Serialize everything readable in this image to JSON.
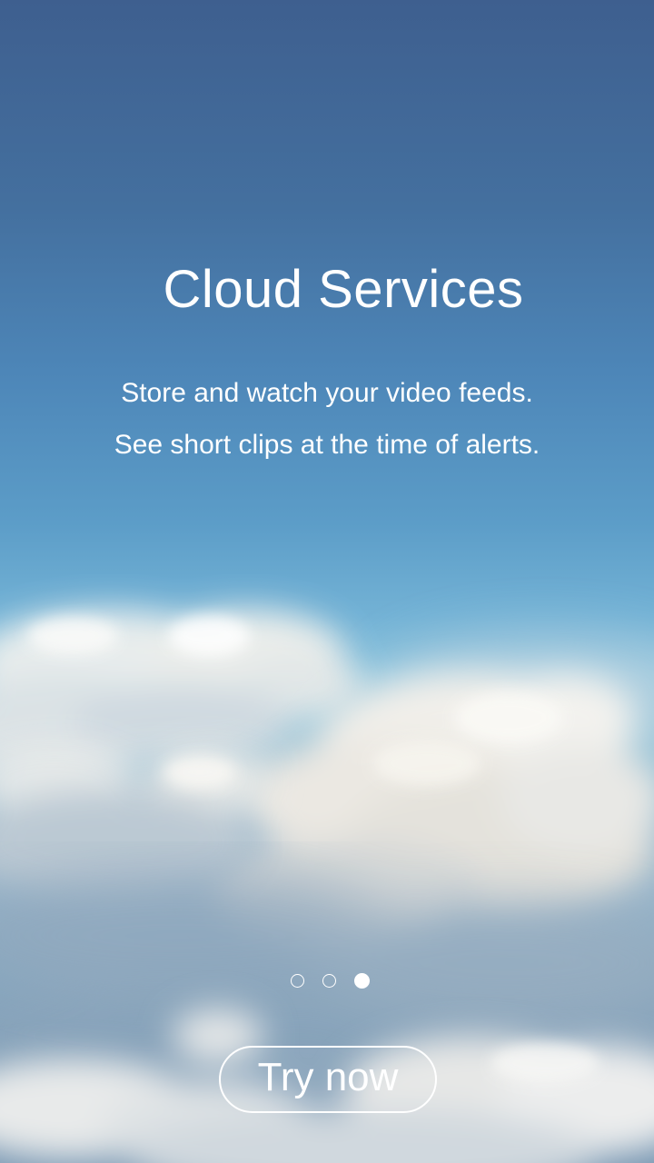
{
  "onboarding": {
    "title": "Cloud Services",
    "description_lines": [
      "Store and watch your video feeds.",
      "See short clips at the time of alerts."
    ],
    "page_indicator": {
      "total": 3,
      "current": 3
    },
    "cta_label": "Try now"
  },
  "colors": {
    "text": "#ffffff",
    "sky_top": "#3e5f8f",
    "sky_horizon": "#9ac6d9"
  }
}
